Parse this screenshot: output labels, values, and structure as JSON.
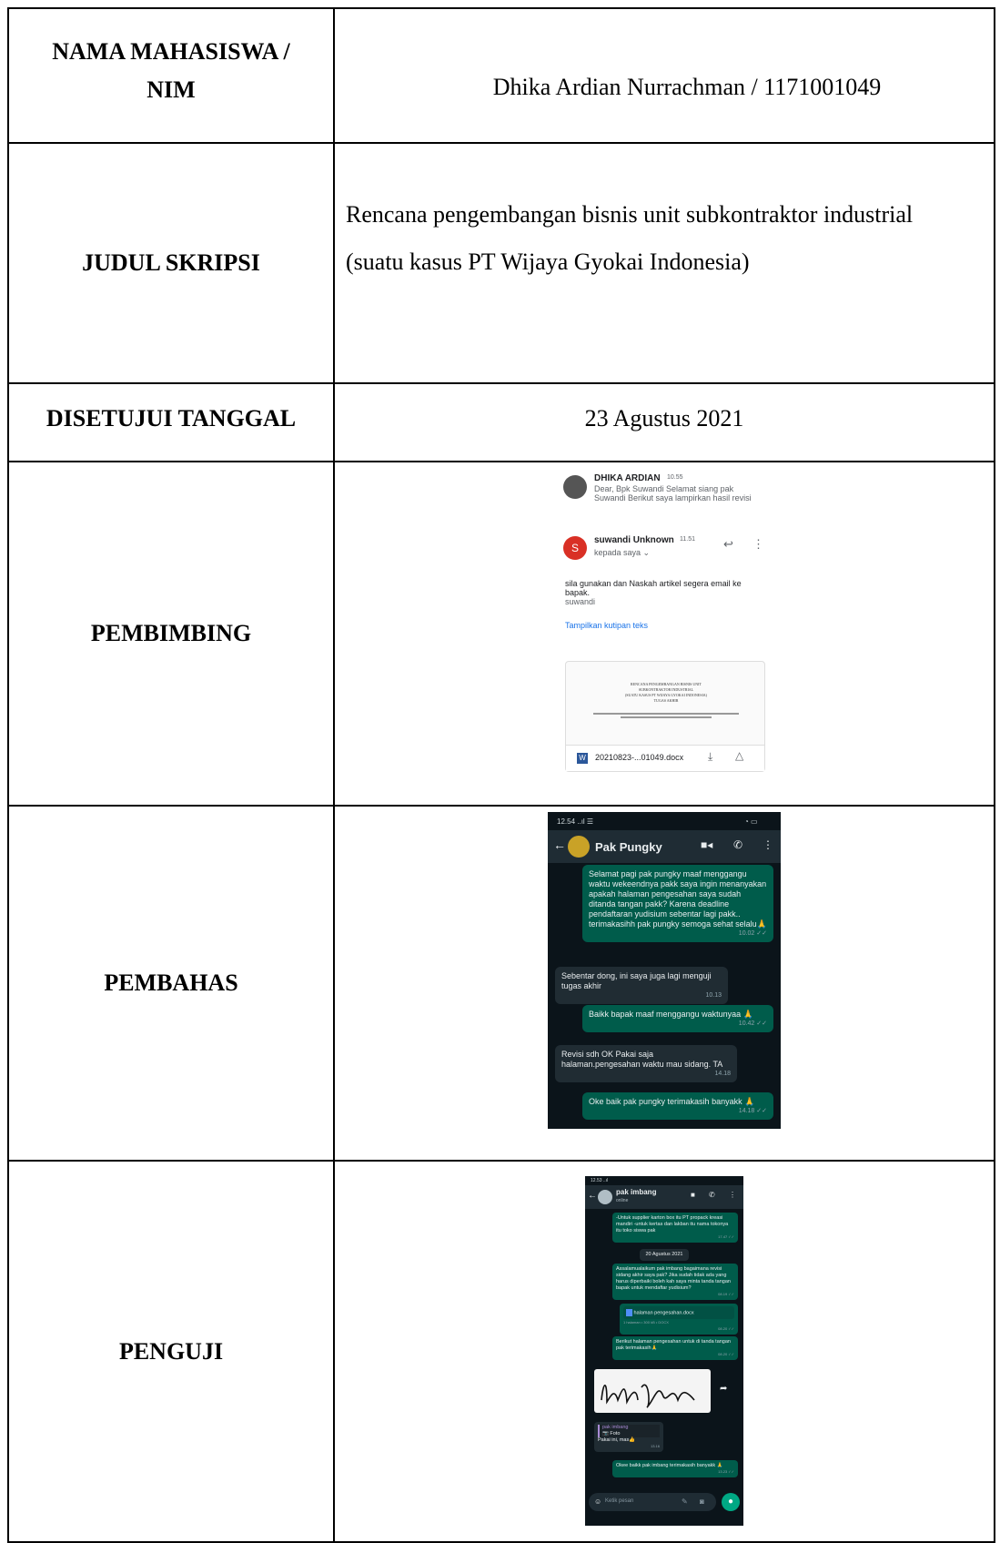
{
  "rows": {
    "nama": {
      "label_line1": "NAMA MAHASISWA /",
      "label_line2": "NIM",
      "value": "Dhika Ardian Nurrachman / 1171001049"
    },
    "judul": {
      "label": "JUDUL SKRIPSI",
      "value_line1": "Rencana pengembangan bisnis unit subkontraktor industrial",
      "value_line2": "(suatu kasus PT Wijaya Gyokai Indonesia)"
    },
    "tanggal": {
      "label": "DISETUJUI TANGGAL",
      "value": "23 Agustus 2021"
    },
    "pembimbing": {
      "label": "PEMBIMBING"
    },
    "pembahas": {
      "label": "PEMBAHAS"
    },
    "penguji": {
      "label": "PENGUJI"
    }
  },
  "email": {
    "sender1_name": "DHIKA ARDIAN",
    "sender1_time": "10.55",
    "sender1_preview_1": "Dear, Bpk Suwandi Selamat siang pak",
    "sender1_preview_2": "Suwandi Berikut saya lampirkan hasil revisi",
    "sender2_initial": "S",
    "sender2_name": "suwandi Unknown",
    "sender2_time": "11.51",
    "sender2_to": "kepada saya ⌄",
    "body_line1": "sila gunakan dan Naskah artikel segera email ke",
    "body_line2": "bapak.",
    "signature": "suwandi",
    "quote_link": "Tampilkan kutipan teks",
    "doc_title_1": "RENCANA PENGEMBANGAN BISNIS UNIT",
    "doc_title_2": "SUBKONTRAKTOR INDUSTRIAL",
    "doc_title_3": "(SUATU KASUS PT WIJAYA GYOKAI INDONESIA)",
    "doc_title_4": "TUGAS AKHIR",
    "attachment_name": "20210823-...01049.docx",
    "accent": "#1a73e8"
  },
  "chat1": {
    "status_time": "12.54",
    "contact": "Pak Pungky",
    "messages": [
      {
        "text": "Selamat pagi pak pungky maaf menggangu waktu wekeendnya pakk saya ingin menanyakan apakah halaman pengesahan saya sudah ditanda tangan pakk? Karena deadline pendaftaran yudisium sebentar lagi pakk.. terimakasihh pak pungky semoga sehat selalu🙏",
        "time": "10.02 ✓✓"
      },
      {
        "text": "Sebentar dong, ini saya juga lagi menguji tugas akhir",
        "time": "10.13"
      },
      {
        "text": "Baikk bapak maaf menggangu waktunyaa 🙏",
        "time": "10.42 ✓✓"
      },
      {
        "text": "Revisi sdh OK Pakai saja halaman.pengesahan waktu mau sidang. TA",
        "time": "14.18"
      },
      {
        "text": "Oke baik pak pungky terimakasih banyakk 🙏",
        "time": "14.18 ✓✓"
      }
    ]
  },
  "chat2": {
    "status_time": "12.53",
    "contact": "pak imbang",
    "contact_status": "online",
    "m1": "-Untuk supplier karton box itu PT propack kreasi mandiri -untuk kertas dan lakban itu nama tokonya itu toko siswa pak",
    "m1_time": "17.47 ✓✓",
    "date_chip": "20 Agustus 2021",
    "m2": "Assalamualaikum pak imbang bagaimana revisi sidang akhir saya pak? Jika sudah tidak ada yang harus diperbaiki boleh kah saya minta tanda tangan bapak untuk mendaftar yudisium?",
    "m2_time": "08.19 ✓✓",
    "file_name": "halaman pengesahan.docx",
    "file_meta": "1 halaman • 300 kB • DOCX",
    "file_time": "08.20 ✓✓",
    "m3": "Berikut halaman pengesahan untuk di tanda tangan pak terimakasih🙏",
    "m3_time": "08.20 ✓✓",
    "reply_name": "pak imbang",
    "reply_kind": "📷 Foto",
    "reply_text": "Pakai ini, mas👍",
    "reply_time": "13.16",
    "m4": "Okee baikk pak imbang terimakasih banyakk 🙏",
    "m4_time": "13.23 ✓✓",
    "input_placeholder": "Ketik pesan"
  }
}
